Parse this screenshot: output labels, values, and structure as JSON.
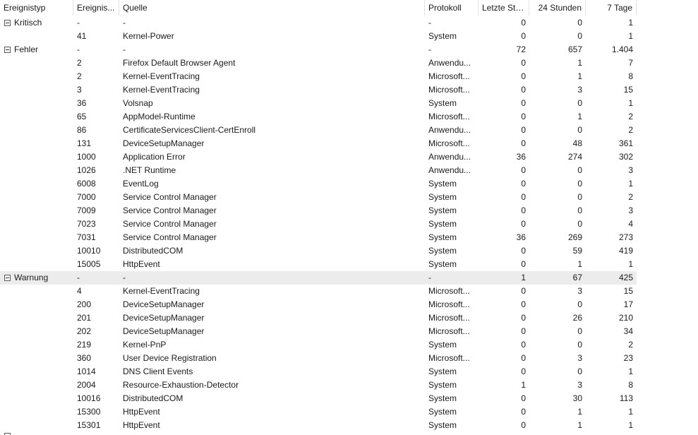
{
  "columns": [
    "Ereignistyp",
    "Ereignis...",
    "Quelle",
    "Protokoll",
    "Letzte Stu...",
    "24 Stunden",
    "7 Tage"
  ],
  "groups": [
    {
      "name": "Kritisch",
      "summary": {
        "id": "-",
        "source": "-",
        "log": "-",
        "h": "0",
        "d": "0",
        "w": "1"
      },
      "rows": [
        {
          "id": "41",
          "source": "Kernel-Power",
          "log": "System",
          "h": "0",
          "d": "0",
          "w": "1"
        }
      ]
    },
    {
      "name": "Fehler",
      "summary": {
        "id": "-",
        "source": "-",
        "log": "-",
        "h": "72",
        "d": "657",
        "w": "1.404"
      },
      "rows": [
        {
          "id": "2",
          "source": "Firefox Default Browser Agent",
          "log": "Anwendu...",
          "h": "0",
          "d": "1",
          "w": "7"
        },
        {
          "id": "2",
          "source": "Kernel-EventTracing",
          "log": "Microsoft...",
          "h": "0",
          "d": "1",
          "w": "8"
        },
        {
          "id": "3",
          "source": "Kernel-EventTracing",
          "log": "Microsoft...",
          "h": "0",
          "d": "3",
          "w": "15"
        },
        {
          "id": "36",
          "source": "Volsnap",
          "log": "System",
          "h": "0",
          "d": "0",
          "w": "1"
        },
        {
          "id": "65",
          "source": "AppModel-Runtime",
          "log": "Microsoft...",
          "h": "0",
          "d": "1",
          "w": "2"
        },
        {
          "id": "86",
          "source": "CertificateServicesClient-CertEnroll",
          "log": "Anwendu...",
          "h": "0",
          "d": "0",
          "w": "2"
        },
        {
          "id": "131",
          "source": "DeviceSetupManager",
          "log": "Microsoft...",
          "h": "0",
          "d": "48",
          "w": "361"
        },
        {
          "id": "1000",
          "source": "Application Error",
          "log": "Anwendu...",
          "h": "36",
          "d": "274",
          "w": "302"
        },
        {
          "id": "1026",
          "source": ".NET Runtime",
          "log": "Anwendu...",
          "h": "0",
          "d": "0",
          "w": "3"
        },
        {
          "id": "6008",
          "source": "EventLog",
          "log": "System",
          "h": "0",
          "d": "0",
          "w": "1"
        },
        {
          "id": "7000",
          "source": "Service Control Manager",
          "log": "System",
          "h": "0",
          "d": "0",
          "w": "2"
        },
        {
          "id": "7009",
          "source": "Service Control Manager",
          "log": "System",
          "h": "0",
          "d": "0",
          "w": "3"
        },
        {
          "id": "7023",
          "source": "Service Control Manager",
          "log": "System",
          "h": "0",
          "d": "0",
          "w": "4"
        },
        {
          "id": "7031",
          "source": "Service Control Manager",
          "log": "System",
          "h": "36",
          "d": "269",
          "w": "273"
        },
        {
          "id": "10010",
          "source": "DistributedCOM",
          "log": "System",
          "h": "0",
          "d": "59",
          "w": "419"
        },
        {
          "id": "15005",
          "source": "HttpEvent",
          "log": "System",
          "h": "0",
          "d": "1",
          "w": "1"
        }
      ]
    },
    {
      "name": "Warnung",
      "highlight": true,
      "summary": {
        "id": "-",
        "source": "-",
        "log": "-",
        "h": "1",
        "d": "67",
        "w": "425"
      },
      "rows": [
        {
          "id": "4",
          "source": "Kernel-EventTracing",
          "log": "Microsoft...",
          "h": "0",
          "d": "3",
          "w": "15"
        },
        {
          "id": "200",
          "source": "DeviceSetupManager",
          "log": "Microsoft...",
          "h": "0",
          "d": "0",
          "w": "17"
        },
        {
          "id": "201",
          "source": "DeviceSetupManager",
          "log": "Microsoft...",
          "h": "0",
          "d": "26",
          "w": "210"
        },
        {
          "id": "202",
          "source": "DeviceSetupManager",
          "log": "Microsoft...",
          "h": "0",
          "d": "0",
          "w": "34"
        },
        {
          "id": "219",
          "source": "Kernel-PnP",
          "log": "System",
          "h": "0",
          "d": "0",
          "w": "2"
        },
        {
          "id": "360",
          "source": "User Device Registration",
          "log": "Microsoft...",
          "h": "0",
          "d": "3",
          "w": "23"
        },
        {
          "id": "1014",
          "source": "DNS Client Events",
          "log": "System",
          "h": "0",
          "d": "0",
          "w": "1"
        },
        {
          "id": "2004",
          "source": "Resource-Exhaustion-Detector",
          "log": "System",
          "h": "1",
          "d": "3",
          "w": "8"
        },
        {
          "id": "10016",
          "source": "DistributedCOM",
          "log": "System",
          "h": "0",
          "d": "30",
          "w": "113"
        },
        {
          "id": "15300",
          "source": "HttpEvent",
          "log": "System",
          "h": "0",
          "d": "1",
          "w": "1"
        },
        {
          "id": "15301",
          "source": "HttpEvent",
          "log": "System",
          "h": "0",
          "d": "1",
          "w": "1"
        }
      ]
    }
  ]
}
